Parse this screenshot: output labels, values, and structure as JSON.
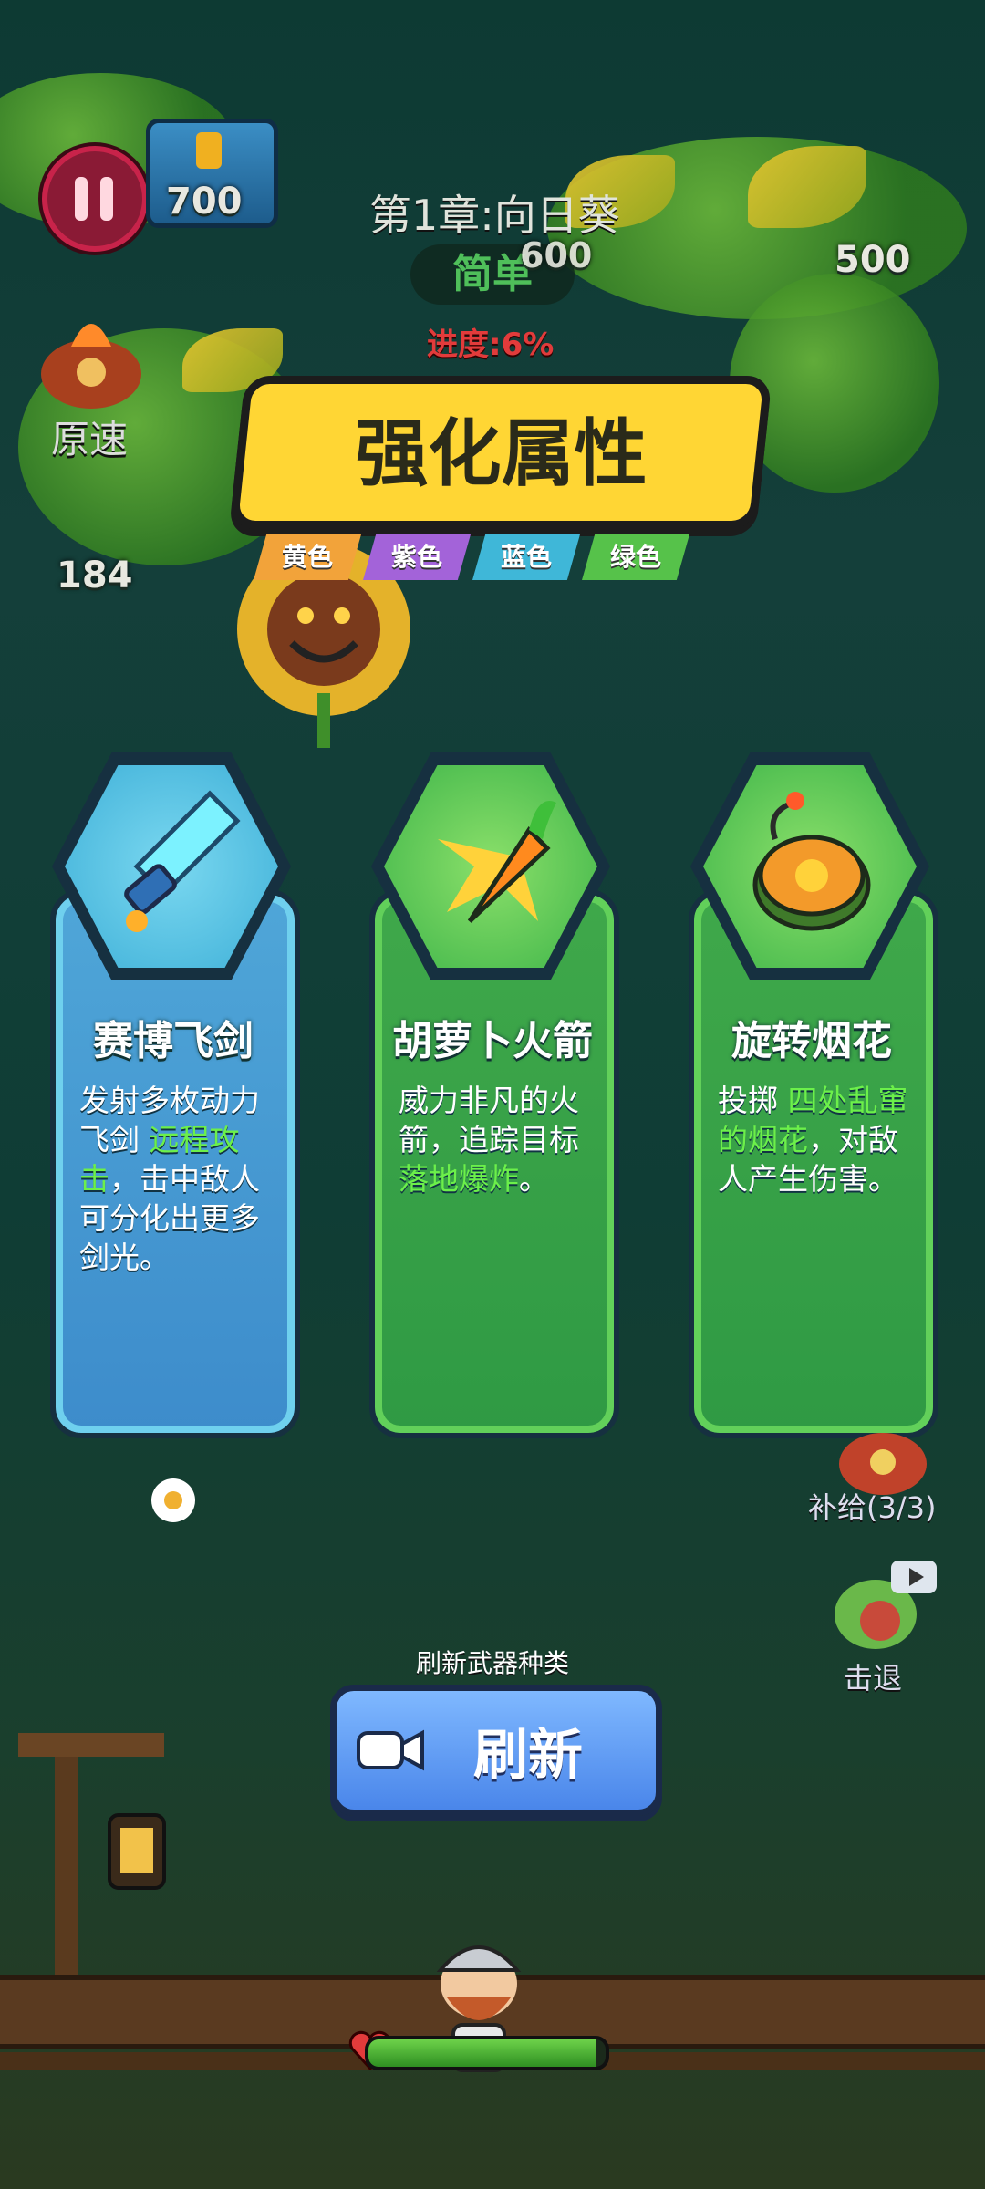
{
  "hud": {
    "chest_count": "700",
    "chapter_title": "第1章:向日葵",
    "difficulty": "简单",
    "progress_text": "进度:6%",
    "speed_label": "原速",
    "enemy_hp_left": "184",
    "enemy_hp_mid": "600",
    "enemy_hp_right": "500",
    "supply_label": "补给(3/3)",
    "knockback_label": "击退"
  },
  "panel": {
    "title": "强化属性",
    "color_tags": [
      {
        "label": "黄色",
        "color": "#f2a33a"
      },
      {
        "label": "紫色",
        "color": "#a363d9"
      },
      {
        "label": "蓝色",
        "color": "#3fb7d8"
      },
      {
        "label": "绿色",
        "color": "#56c24a"
      }
    ]
  },
  "cards": [
    {
      "name": "赛博飞剑",
      "icon": "cyber-sword-icon",
      "theme_color": "#5cc2e6",
      "desc_parts": [
        "发射多枚动力飞剑 ",
        "远程攻击",
        "，击中敌人可分化出更多剑光。"
      ]
    },
    {
      "name": "胡萝卜火箭",
      "icon": "carrot-rocket-icon",
      "theme_color": "#48b84a",
      "desc_parts": [
        "威力非凡的火箭，追踪目标",
        "落地爆炸",
        "。"
      ]
    },
    {
      "name": "旋转烟花",
      "icon": "spinning-firework-icon",
      "theme_color": "#48b84a",
      "desc_parts": [
        "投掷 ",
        "四处乱窜的烟花",
        "，对敌人产生伤害。"
      ]
    }
  ],
  "refresh": {
    "hint": "刷新武器种类",
    "label": "刷新",
    "icon": "video-camera-icon"
  },
  "player": {
    "hp_fraction": 0.96
  }
}
